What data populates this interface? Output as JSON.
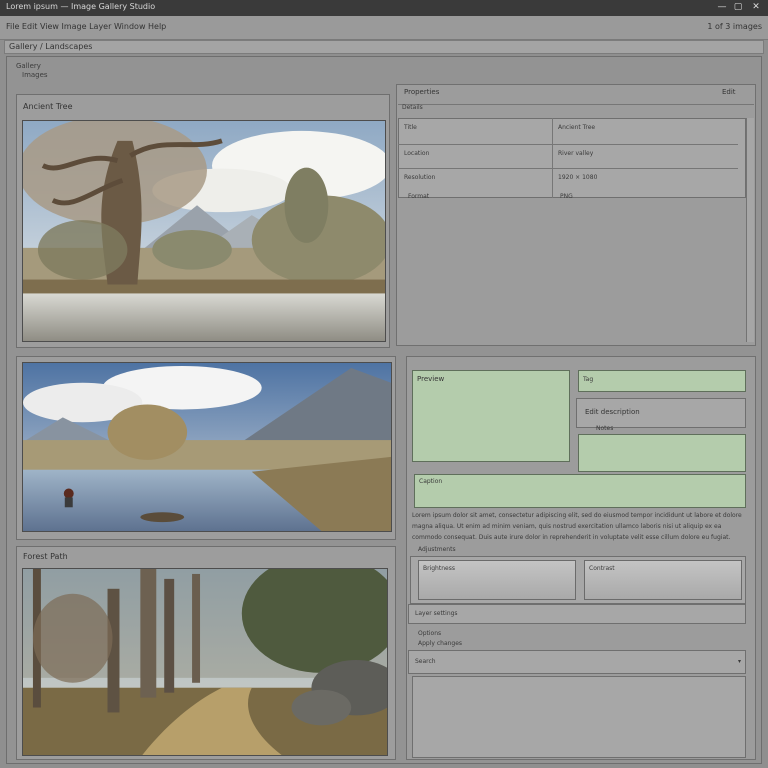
{
  "window": {
    "title": "Lorem ipsum — Image Gallery Studio",
    "controls": [
      "—",
      "▢",
      "✕"
    ]
  },
  "menubar": {
    "left_text": "File  Edit  View  Image  Layer  Window  Help",
    "right_text": "1 of 3 images"
  },
  "address": {
    "value": "Gallery / Landscapes"
  },
  "left_header": {
    "line1": "Gallery",
    "line2": "Images"
  },
  "left_column": {
    "panel1_label": "Ancient Tree",
    "panel3_label": "Forest Path"
  },
  "right_top": {
    "title": "Properties",
    "corner_label": "Edit",
    "subheader": "Details",
    "rows": [
      {
        "label": "Title",
        "value": "Ancient Tree"
      },
      {
        "label": "Location",
        "value": "River valley"
      },
      {
        "label": "Resolution",
        "value": "1920 × 1080"
      },
      {
        "label": "Format",
        "value": "PNG"
      }
    ]
  },
  "right_bottom": {
    "green_main_label": "Preview",
    "green_side_label": "Tag",
    "mid_label": "Edit description",
    "small_label": "Notes",
    "wide_label": "Caption",
    "paragraph": [
      "Lorem ipsum dolor sit amet, consectetur adipiscing elit, sed do eiusmod tempor incididunt ut labore et dolore",
      "magna aliqua. Ut enim ad minim veniam, quis nostrud exercitation ullamco laboris nisi ut aliquip ex ea",
      "commodo consequat. Duis aute irure dolor in reprehenderit in voluptate velit esse cillum dolore eu fugiat."
    ],
    "subsection_label": "Adjustments",
    "gray_box1": "Brightness",
    "gray_box2": "Contrast",
    "footer_bar": "Layer settings",
    "footer_text1": "Options",
    "footer_text2": "Apply changes",
    "footer_input": "Search"
  },
  "colors": {
    "accent_green": "#b4ccac",
    "panel_gray": "#9c9c9c",
    "titlebar": "#3a3a3a"
  }
}
